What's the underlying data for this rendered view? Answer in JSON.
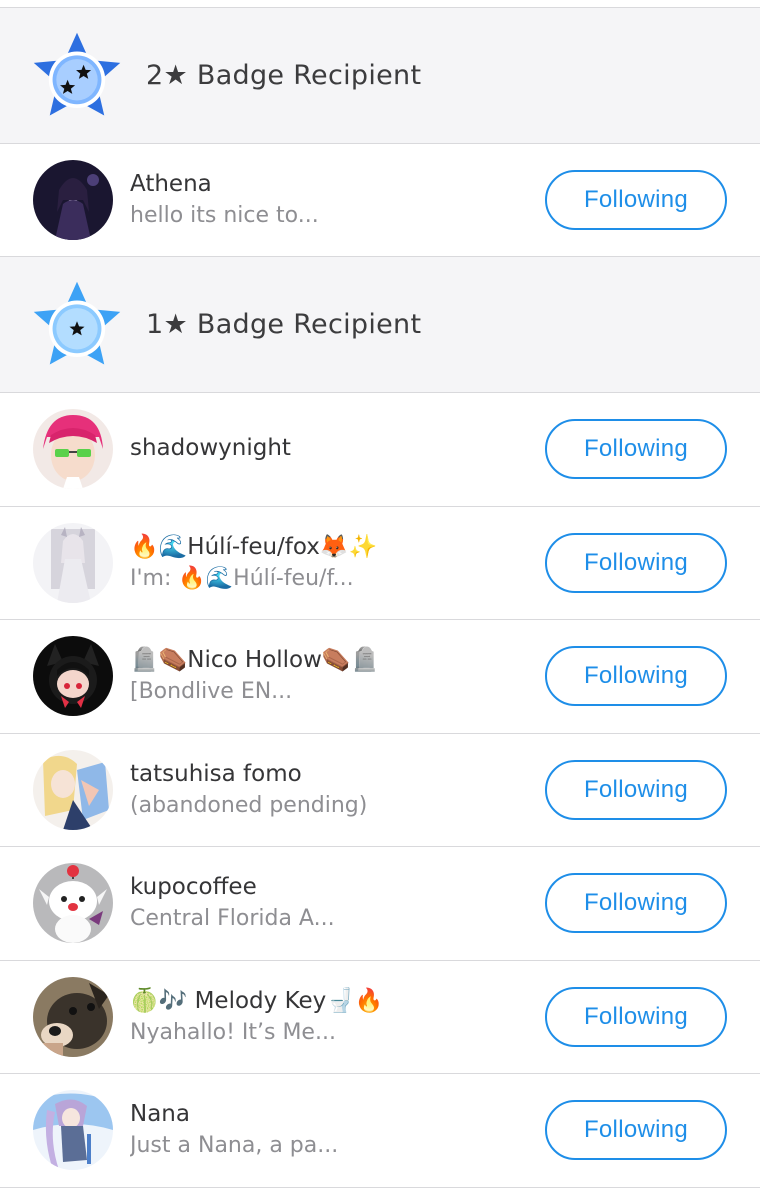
{
  "sections": [
    {
      "title": "2★ Badge Recipient",
      "badge_icon": "two-star-badge-icon",
      "users": [
        {
          "name": "Athena",
          "bio": "hello its nice to...",
          "button": "Following"
        }
      ]
    },
    {
      "title": "1★ Badge Recipient",
      "badge_icon": "one-star-badge-icon",
      "users": [
        {
          "name": "shadowynight",
          "bio": "",
          "button": "Following"
        },
        {
          "name": "🔥🌊Húlí-feu/fox🦊✨",
          "bio": "I'm: 🔥🌊Húlí-feu/f...",
          "button": "Following"
        },
        {
          "name": "🪦⚰️Nico Hollow⚰️🪦",
          "bio": "[Bondlive EN...",
          "button": "Following"
        },
        {
          "name": "tatsuhisa fomo",
          "bio": "(abandoned pending)",
          "button": "Following"
        },
        {
          "name": "kupocoffee",
          "bio": "Central Florida A...",
          "button": "Following"
        },
        {
          "name": "🍈🎶 Melody Key🚽🔥",
          "bio": "Nyahallo! It’s Me...",
          "button": "Following"
        },
        {
          "name": "Nana",
          "bio": "Just a Nana, a pa...",
          "button": "Following"
        }
      ]
    }
  ],
  "colors": {
    "accent": "#1e8ee8",
    "header_bg": "#f5f5f7",
    "divider": "#d9d9dc",
    "badge_blue": "#3d8ef0",
    "badge_light": "#8fc8ff"
  }
}
